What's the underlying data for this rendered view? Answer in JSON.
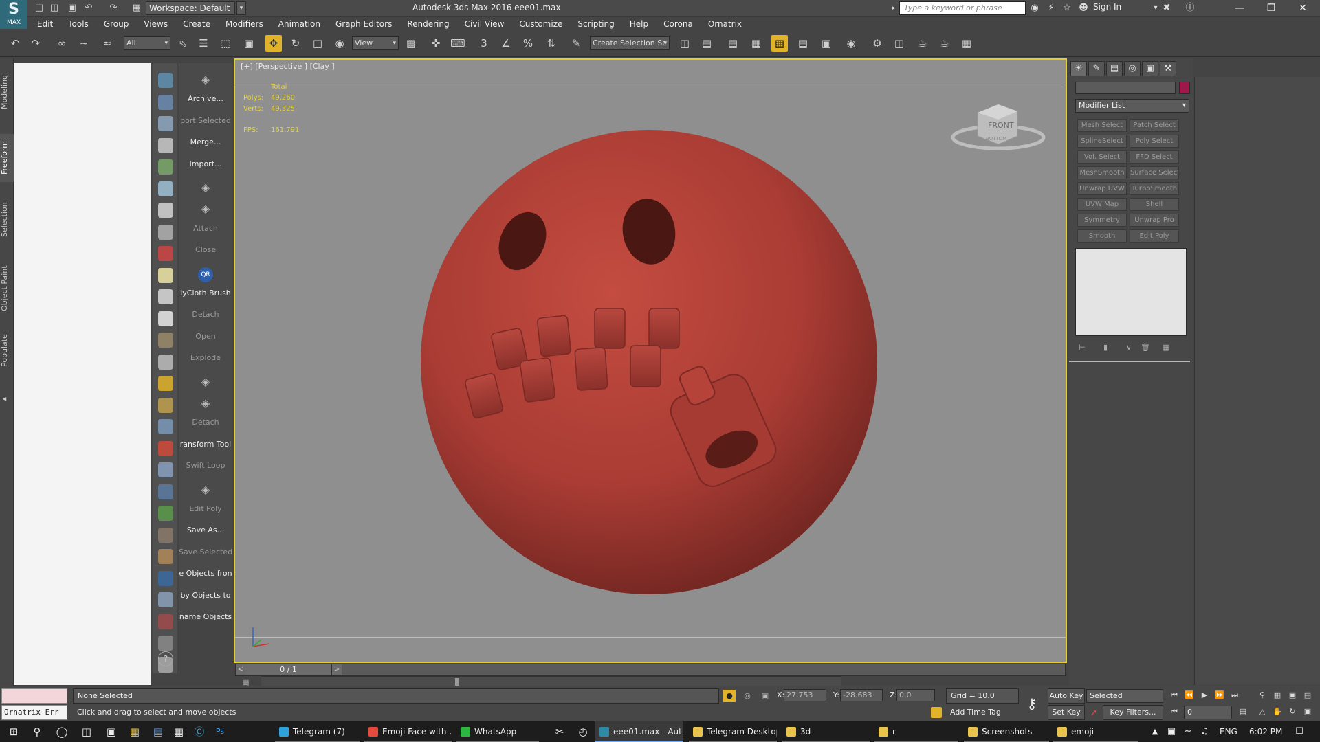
{
  "window": {
    "title": "Autodesk 3ds Max 2016      eee01.max",
    "workspace": "Workspace: Default",
    "search_placeholder": "Type a keyword or phrase",
    "sign_in": "Sign In",
    "app_logo": "MAX"
  },
  "menu": [
    "Edit",
    "Tools",
    "Group",
    "Views",
    "Create",
    "Modifiers",
    "Animation",
    "Graph Editors",
    "Rendering",
    "Civil View",
    "Customize",
    "Scripting",
    "Help",
    "Corona",
    "Ornatrix"
  ],
  "toolbar": {
    "filter": "All",
    "ref_coord": "View",
    "selection_set": "Create Selection Se",
    "snap_label": "3"
  },
  "ribbon_tabs": [
    "Modeling",
    "Freeform",
    "Selection",
    "Object Paint",
    "Populate"
  ],
  "commands": [
    {
      "label": "",
      "state": "icon"
    },
    {
      "label": "Archive...",
      "state": "on"
    },
    {
      "label": "port Selected",
      "state": "dis"
    },
    {
      "label": "Merge...",
      "state": "on"
    },
    {
      "label": "Import...",
      "state": "on"
    },
    {
      "label": "",
      "state": "icon"
    },
    {
      "label": "",
      "state": "icon"
    },
    {
      "label": "Attach",
      "state": "dis"
    },
    {
      "label": "Close",
      "state": "dis"
    },
    {
      "label": "QR",
      "state": "qr"
    },
    {
      "label": "lyCloth Brush",
      "state": "on"
    },
    {
      "label": "Detach",
      "state": "dis"
    },
    {
      "label": "Open",
      "state": "dis"
    },
    {
      "label": "Explode",
      "state": "dis"
    },
    {
      "label": "",
      "state": "icon"
    },
    {
      "label": "",
      "state": "icon"
    },
    {
      "label": "Detach",
      "state": "dis"
    },
    {
      "label": "ransform Tool",
      "state": "on"
    },
    {
      "label": "Swift Loop",
      "state": "dis"
    },
    {
      "label": "",
      "state": "icon"
    },
    {
      "label": "Edit Poly",
      "state": "dis"
    },
    {
      "label": "Save As...",
      "state": "on"
    },
    {
      "label": "Save Selected",
      "state": "dis"
    },
    {
      "label": "e Objects fron",
      "state": "on"
    },
    {
      "label": "by Objects to",
      "state": "on"
    },
    {
      "label": "name Objects",
      "state": "on"
    }
  ],
  "viewport": {
    "label": "[+] [Perspective ] [Clay ]",
    "stats_header": "Total",
    "polys_label": "Polys:",
    "polys": "49,260",
    "verts_label": "Verts:",
    "verts": "49,325",
    "fps_label": "FPS:",
    "fps": "161.791",
    "viewcube_front": "FRONT",
    "viewcube_bottom": "BOTTOM",
    "object_color": "#b5443c"
  },
  "timeslider": {
    "frame": "0 / 1"
  },
  "command_panel": {
    "modifier_list": "Modifier List",
    "object_color": "#a0174b",
    "modifiers": [
      "Mesh Select",
      "Patch Select",
      "SplineSelect",
      "Poly Select",
      "Vol. Select",
      "FFD Select",
      "MeshSmooth",
      "Surface Select",
      "Unwrap UVW",
      "TurboSmooth",
      "UVW Map",
      "Shell",
      "Symmetry",
      "Unwrap Pro",
      "Smooth",
      "Edit Poly"
    ]
  },
  "status": {
    "ornatrix": "Ornatrix Err",
    "selection": "None Selected",
    "prompt": "Click and drag to select and move objects",
    "x_label": "X:",
    "x": "27.753",
    "y_label": "Y:",
    "y": "-28.683",
    "z_label": "Z:",
    "z": "0.0",
    "grid": "Grid = 10.0",
    "add_time_tag": "Add Time Tag",
    "auto_key": "Auto Key",
    "set_key": "Set Key",
    "key_mode": "Selected",
    "key_filters": "Key Filters...",
    "current_frame": "0"
  },
  "taskbar": {
    "items": [
      {
        "label": "Telegram (7)",
        "color": "#2fa3d9",
        "state": "open"
      },
      {
        "label": "Emoji Face with ...",
        "color": "#e44b3c",
        "state": "open"
      },
      {
        "label": "WhatsApp",
        "color": "#2bb741",
        "state": "open"
      },
      {
        "label": "eee01.max - Aut...",
        "color": "#2f8aa6",
        "state": "active"
      },
      {
        "label": "Telegram Desktop",
        "color": "#e8c44d",
        "state": "open"
      },
      {
        "label": "3d",
        "color": "#e8c44d",
        "state": "open"
      },
      {
        "label": "r",
        "color": "#e8c44d",
        "state": "open"
      },
      {
        "label": "Screenshots",
        "color": "#e8c44d",
        "state": "open"
      },
      {
        "label": "emoji",
        "color": "#e8c44d",
        "state": "open"
      }
    ],
    "language": "ENG",
    "time": "6:02 PM"
  }
}
